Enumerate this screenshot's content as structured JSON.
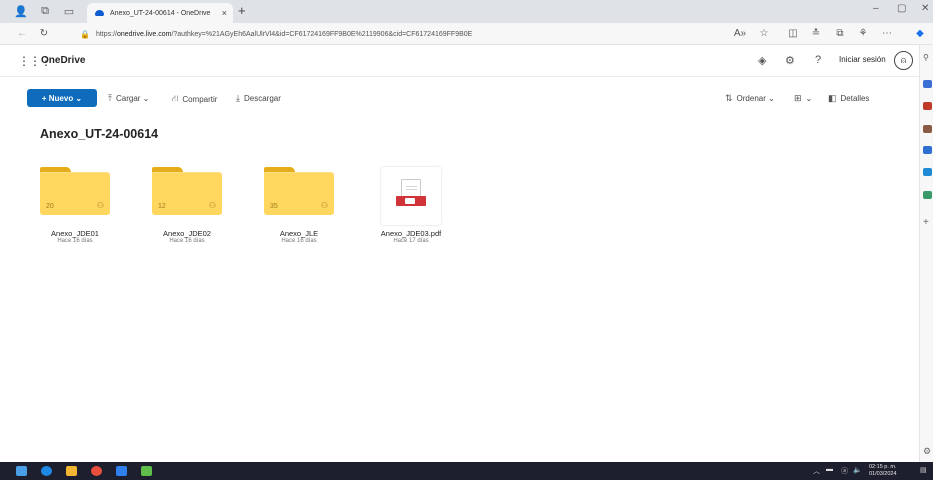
{
  "browser": {
    "tab_title": "Anexo_UT-24-00614 - OneDrive",
    "tab_close": "×",
    "new_tab": "+",
    "url_prefix": "https://",
    "url_domain": "onedrive.live.com",
    "url_rest": "/?authkey=%21AGyEh6AalUlrVl4&id=CF61724169FF9B0E%2119906&cid=CF61724169FF9B0E"
  },
  "header": {
    "app_name": "OneDrive",
    "signin_label": "Iniciar sesión"
  },
  "toolbar": {
    "new_label": "+ Nuevo ⌄",
    "upload_label": "Cargar ⌄",
    "share_label": "Compartir",
    "download_label": "Descargar",
    "sort_label": "Ordenar ⌄",
    "view_label": "⌄",
    "details_label": "Detalles"
  },
  "page": {
    "title": "Anexo_UT-24-00614"
  },
  "items": [
    {
      "name": "Anexo_JDE01",
      "modified": "Hace 16 días",
      "count": "20",
      "type": "folder"
    },
    {
      "name": "Anexo_JDE02",
      "modified": "Hace 16 días",
      "count": "12",
      "type": "folder"
    },
    {
      "name": "Anexo_JLE",
      "modified": "Hace 16 días",
      "count": "35",
      "type": "folder"
    },
    {
      "name": "Anexo_JDE03.pdf",
      "modified": "Hace 17 días",
      "type": "pdf"
    }
  ],
  "taskbar": {
    "time": "02:15 p. m.",
    "date": "01/03/2024"
  },
  "colors": {
    "accent": "#0f6cbd",
    "folder": "#ffd75e",
    "pdf": "#d13438"
  }
}
